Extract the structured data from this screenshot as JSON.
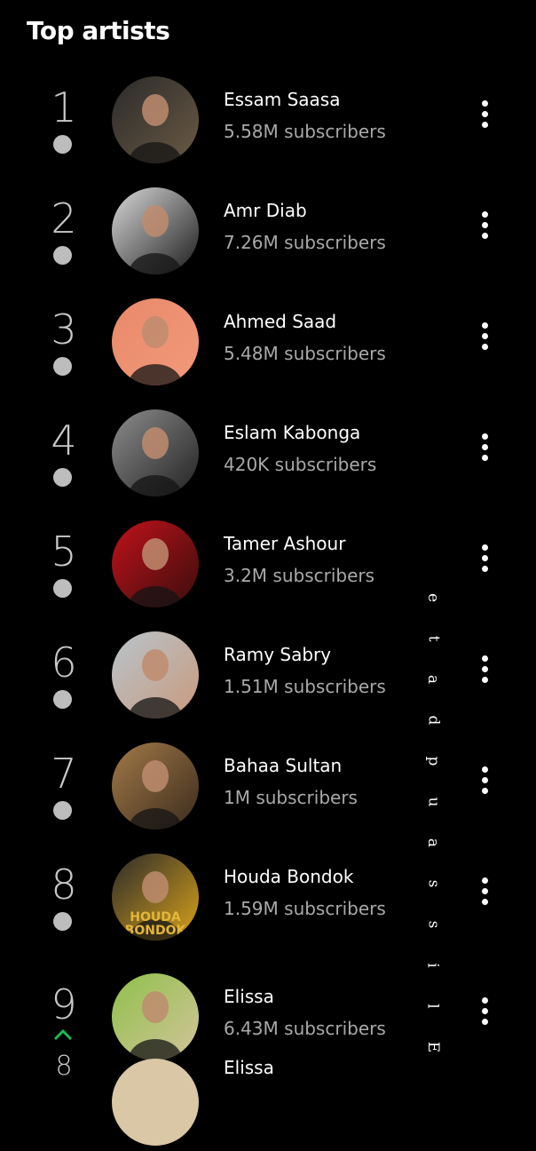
{
  "section": {
    "title": "Top artists"
  },
  "artists": [
    {
      "rank": "1",
      "name": "Essam Saasa",
      "subscribers": "5.58M subscribers",
      "trend": "none",
      "avatar_colors": [
        "#2a2a2a",
        "#6b5a44"
      ]
    },
    {
      "rank": "2",
      "name": "Amr Diab",
      "subscribers": "7.26M subscribers",
      "trend": "none",
      "avatar_colors": [
        "#d9d9d9",
        "#1c1c1c"
      ]
    },
    {
      "rank": "3",
      "name": "Ahmed Saad",
      "subscribers": "5.48M subscribers",
      "trend": "none",
      "avatar_colors": [
        "#e8896a",
        "#f29a7b"
      ]
    },
    {
      "rank": "4",
      "name": "Eslam Kabonga",
      "subscribers": "420K subscribers",
      "trend": "none",
      "avatar_colors": [
        "#8c8c8c",
        "#222222"
      ]
    },
    {
      "rank": "5",
      "name": "Tamer Ashour",
      "subscribers": "3.2M subscribers",
      "trend": "none",
      "avatar_colors": [
        "#c0121a",
        "#3a0d0d"
      ]
    },
    {
      "rank": "6",
      "name": "Ramy Sabry",
      "subscribers": "1.51M subscribers",
      "trend": "none",
      "avatar_colors": [
        "#b8c4cc",
        "#c99a7c"
      ]
    },
    {
      "rank": "7",
      "name": "Bahaa Sultan",
      "subscribers": "1M subscribers",
      "trend": "none",
      "avatar_colors": [
        "#a27a48",
        "#3b2b1d"
      ]
    },
    {
      "rank": "8",
      "name": "Houda Bondok",
      "subscribers": "1.59M subscribers",
      "trend": "none",
      "avatar_colors": [
        "#2b2b2b",
        "#d9a21b"
      ],
      "avatar_text": [
        "HOUDA",
        "BONDOK"
      ]
    },
    {
      "rank": "9",
      "name": "Elissa",
      "subscribers": "6.43M subscribers",
      "trend": "up",
      "avatar_colors": [
        "#8fc14a",
        "#d3c29b"
      ]
    }
  ],
  "partial_next": {
    "rank": "8",
    "name": "Elissa"
  },
  "watermark": {
    "text": "Elissa update",
    "chars": [
      "E",
      "l",
      "i",
      "s",
      "s",
      "a",
      "u",
      "p",
      "d",
      "a",
      "t",
      "e"
    ]
  },
  "colors": {
    "background": "#000000",
    "rank_text": "#c8c8c8",
    "subtitle": "#a9a9a9",
    "trend_up": "#1db954"
  },
  "icons": {
    "more": "more-vert-icon",
    "rank_same": "dot-icon",
    "rank_up": "chevron-up-icon"
  }
}
